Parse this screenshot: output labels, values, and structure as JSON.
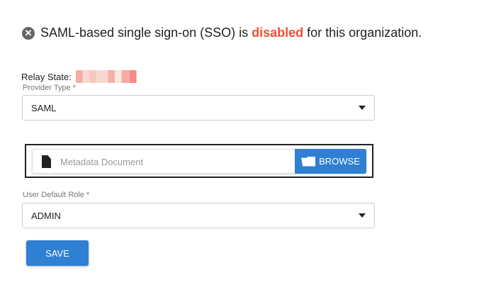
{
  "banner": {
    "prefix": "SAML-based single sign-on (SSO) is ",
    "status": "disabled",
    "suffix": " for this organization."
  },
  "relay": {
    "label": "Relay State:"
  },
  "provider": {
    "label": "Provider Type *",
    "value": "SAML"
  },
  "metadata": {
    "placeholder": "Metadata Document",
    "browse": "BROWSE"
  },
  "role": {
    "label": "User Default Role *",
    "value": "ADMIN"
  },
  "save": "SAVE",
  "colors": {
    "accent": "#2f7fd3",
    "disabled": "#f04e30"
  }
}
